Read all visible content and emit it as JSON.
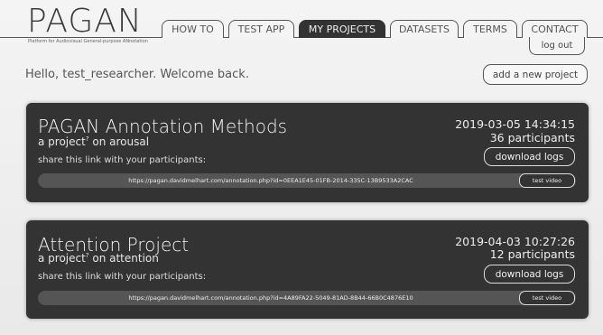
{
  "logo": {
    "title": "PAGAN",
    "subtitle": "Platform for Audiovisual General-purpose ANnotation"
  },
  "nav": {
    "tabs": [
      {
        "label": "HOW TO"
      },
      {
        "label": "TEST APP"
      },
      {
        "label": "MY PROJECTS",
        "active": true
      },
      {
        "label": "DATASETS"
      },
      {
        "label": "TERMS"
      },
      {
        "label": "CONTACT"
      }
    ],
    "logout": "log out"
  },
  "welcome": "Hello, test_researcher. Welcome back.",
  "add_project": "add a new project",
  "projects": [
    {
      "title": "PAGAN Annotation Methods",
      "subtitle_prefix": "a project",
      "subtitle_mark": "?",
      "subtitle_suffix": " on arousal",
      "share_text": "share this link with your participants:",
      "date": "2019-03-05 14:34:15",
      "participants": "36 participants",
      "download": "download logs",
      "link": "https://pagan.davidmelhart.com/annotation.php?id=0EEA1E45-01FB-2014-335C-13B9533A2CAC",
      "test_video": "test video"
    },
    {
      "title": "Attention Project",
      "subtitle_prefix": "a project",
      "subtitle_mark": "?",
      "subtitle_suffix": " on attention",
      "share_text": "share this link with your participants:",
      "date": "2019-04-03 10:27:26",
      "participants": "12 participants",
      "download": "download logs",
      "link": "https://pagan.davidmelhart.com/annotation.php?id=4A89FA22-5049-81AD-8B44-66B0C4876E10",
      "test_video": "test video"
    }
  ],
  "colors": {
    "card_bg": "#333333",
    "link_bar": "#555555",
    "page_bg": "#f2f2f2"
  }
}
